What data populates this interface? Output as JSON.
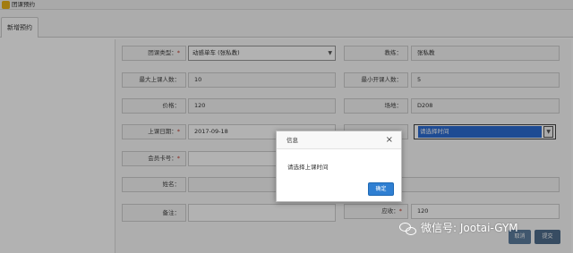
{
  "window": {
    "title": "团课预约"
  },
  "tabs": [
    {
      "label": "新增预约"
    }
  ],
  "form": {
    "course_type_label": "团课类型：",
    "course_type_value": "动感单车 (张私教)",
    "coach_label": "教练：",
    "coach_value": "张私教",
    "max_label": "最大上课人数：",
    "max_value": "10",
    "min_label": "最小开课人数：",
    "min_value": "5",
    "price_label": "价格：",
    "price_value": "120",
    "venue_label": "场地：",
    "venue_value": "D208",
    "date_label": "上课日期：",
    "date_value": "2017-09-18",
    "time_value": "请选择时间",
    "card_label": "会员卡号：",
    "name_label": "姓名：",
    "note_label": "备注：",
    "receivable_label": "应收：",
    "receivable_value": "120",
    "required_mark": "*"
  },
  "dialog": {
    "title": "信息",
    "close": "×",
    "message": "请选择上课时间",
    "ok_label": "确定"
  },
  "actions": {
    "cancel_label": "取消",
    "submit_label": "提交"
  },
  "watermark": {
    "text": "微信号: Jootai-GYM"
  },
  "colors": {
    "accent": "#2f7fd2",
    "highlight": "#2b6cd3",
    "required": "#c0392b"
  }
}
